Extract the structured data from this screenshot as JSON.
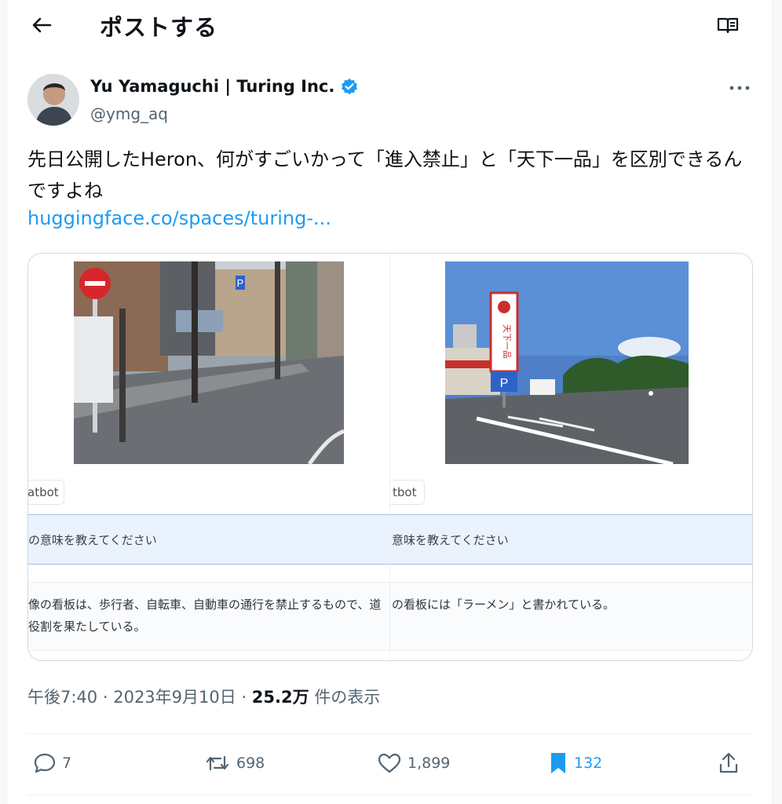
{
  "header": {
    "title": "ポストする"
  },
  "author": {
    "name": "Yu Yamaguchi | Turing Inc.",
    "handle": "@ymg_aq",
    "verified_color": "#1d9bf0"
  },
  "tweet": {
    "text": "先日公開したHeron、何がすごいかって「進入禁止」と「天下一品」を区別できるんですよね",
    "link": "huggingface.co/spaces/turing-..."
  },
  "media": {
    "left": {
      "chip": "atbot",
      "prompt": "の意味を教えてください",
      "answer_lines": [
        "像の看板は、歩行者、自転車、自動車の通行を禁止するもので、道",
        "役割を果たしている。"
      ],
      "photo_sign": "P"
    },
    "right": {
      "chip": "tbot",
      "prompt": "意味を教えてください",
      "answer_lines": [
        "の看板には「ラーメン」と書かれている。"
      ],
      "photo_sign": "天下一品",
      "photo_parking": "P"
    }
  },
  "meta": {
    "time": "午後7:40",
    "date": "2023年9月10日",
    "views_count": "25.2万",
    "views_label": "件の表示"
  },
  "actions": {
    "replies": "7",
    "reposts": "698",
    "likes": "1,899",
    "bookmarks": "132"
  },
  "colors": {
    "accent": "#1d9bf0",
    "muted": "#536471"
  }
}
